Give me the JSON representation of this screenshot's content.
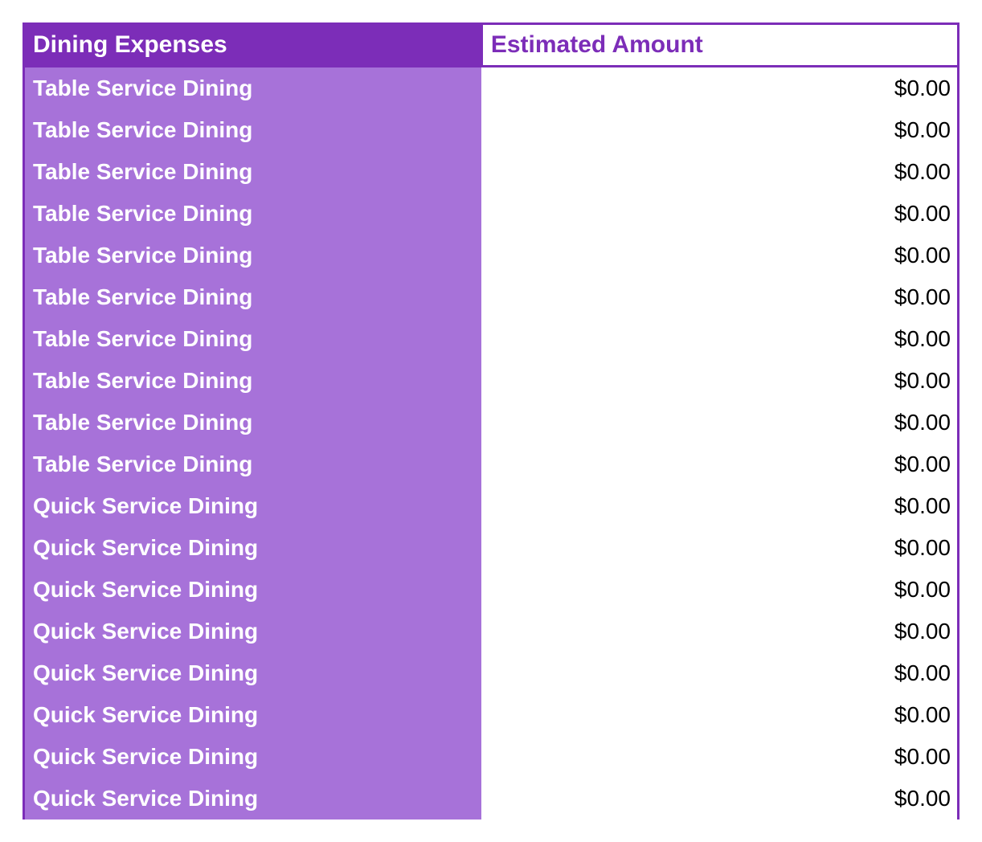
{
  "table": {
    "headers": {
      "left": "Dining Expenses",
      "right": "Estimated Amount"
    },
    "rows": [
      {
        "label": "Table Service Dining",
        "amount": "$0.00"
      },
      {
        "label": "Table Service Dining",
        "amount": "$0.00"
      },
      {
        "label": "Table Service Dining",
        "amount": "$0.00"
      },
      {
        "label": "Table Service Dining",
        "amount": "$0.00"
      },
      {
        "label": "Table Service Dining",
        "amount": "$0.00"
      },
      {
        "label": "Table Service Dining",
        "amount": "$0.00"
      },
      {
        "label": "Table Service Dining",
        "amount": "$0.00"
      },
      {
        "label": "Table Service Dining",
        "amount": "$0.00"
      },
      {
        "label": "Table Service Dining",
        "amount": "$0.00"
      },
      {
        "label": "Table Service Dining",
        "amount": "$0.00"
      },
      {
        "label": "Quick Service Dining",
        "amount": "$0.00"
      },
      {
        "label": "Quick Service Dining",
        "amount": "$0.00"
      },
      {
        "label": "Quick Service Dining",
        "amount": "$0.00"
      },
      {
        "label": "Quick Service Dining",
        "amount": "$0.00"
      },
      {
        "label": "Quick Service Dining",
        "amount": "$0.00"
      },
      {
        "label": "Quick Service Dining",
        "amount": "$0.00"
      },
      {
        "label": "Quick Service Dining",
        "amount": "$0.00"
      },
      {
        "label": "Quick Service Dining",
        "amount": "$0.00"
      }
    ]
  }
}
